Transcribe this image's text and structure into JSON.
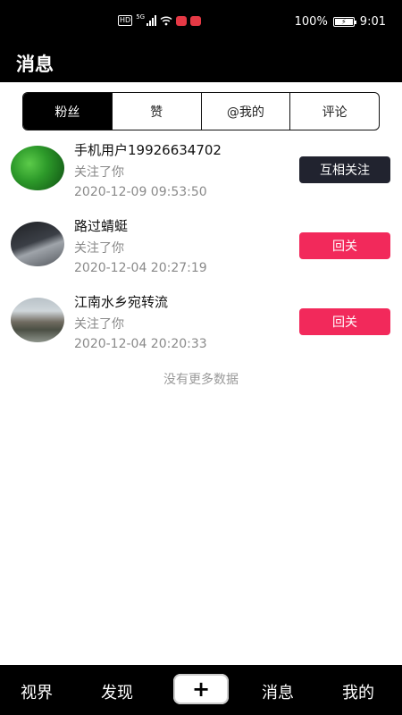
{
  "status_bar": {
    "hd_label": "HD",
    "network_label": "5G",
    "battery_text": "100%",
    "time": "9:01",
    "icons": [
      "hd-icon",
      "signal-icon",
      "wifi-icon",
      "app-notification-icon",
      "app-notification-icon",
      "battery-icon"
    ]
  },
  "header": {
    "title": "消息"
  },
  "tabs": [
    {
      "label": "粉丝",
      "active": true
    },
    {
      "label": "赞",
      "active": false
    },
    {
      "label": "@我的",
      "active": false
    },
    {
      "label": "评论",
      "active": false
    }
  ],
  "followers": [
    {
      "name": "手机用户19926634702",
      "action": "关注了你",
      "time": "2020-12-09 09:53:50",
      "button": "互相关注",
      "button_style": "mutual"
    },
    {
      "name": "路过蜻蜓",
      "action": "关注了你",
      "time": "2020-12-04 20:27:19",
      "button": "回关",
      "button_style": "follow-back"
    },
    {
      "name": "江南水乡宛转流",
      "action": "关注了你",
      "time": "2020-12-04 20:20:33",
      "button": "回关",
      "button_style": "follow-back"
    }
  ],
  "list_footer": "没有更多数据",
  "bottom_nav": {
    "items": [
      "视界",
      "发现",
      "消息",
      "我的"
    ],
    "plus_icon": "+"
  },
  "colors": {
    "background": "#000000",
    "content_bg": "#ffffff",
    "follow_back": "#f2295b",
    "mutual": "#21232f",
    "secondary_text": "#8a8a8a"
  }
}
